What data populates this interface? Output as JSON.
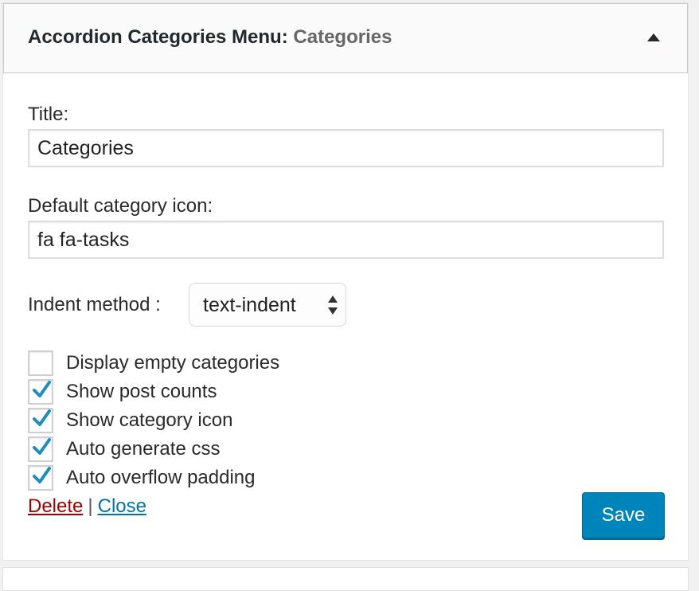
{
  "widget": {
    "title": "Accordion Categories Menu:",
    "subtitle": "Categories"
  },
  "form": {
    "title_label": "Title:",
    "title_value": "Categories",
    "icon_label": "Default category icon:",
    "icon_value": "fa fa-tasks",
    "indent_label": "Indent method :",
    "indent_value": "text-indent"
  },
  "checkboxes": [
    {
      "label": "Display empty categories",
      "checked": false
    },
    {
      "label": "Show post counts",
      "checked": true
    },
    {
      "label": "Show category icon",
      "checked": true
    },
    {
      "label": "Auto generate css",
      "checked": true
    },
    {
      "label": "Auto overflow padding",
      "checked": true
    }
  ],
  "actions": {
    "delete_label": "Delete",
    "separator": "|",
    "close_label": "Close",
    "save_label": "Save"
  },
  "colors": {
    "checkmark": "#1e8cbe",
    "save_bg": "#0085ba",
    "delete_link": "#a00000",
    "close_link": "#0073aa"
  }
}
